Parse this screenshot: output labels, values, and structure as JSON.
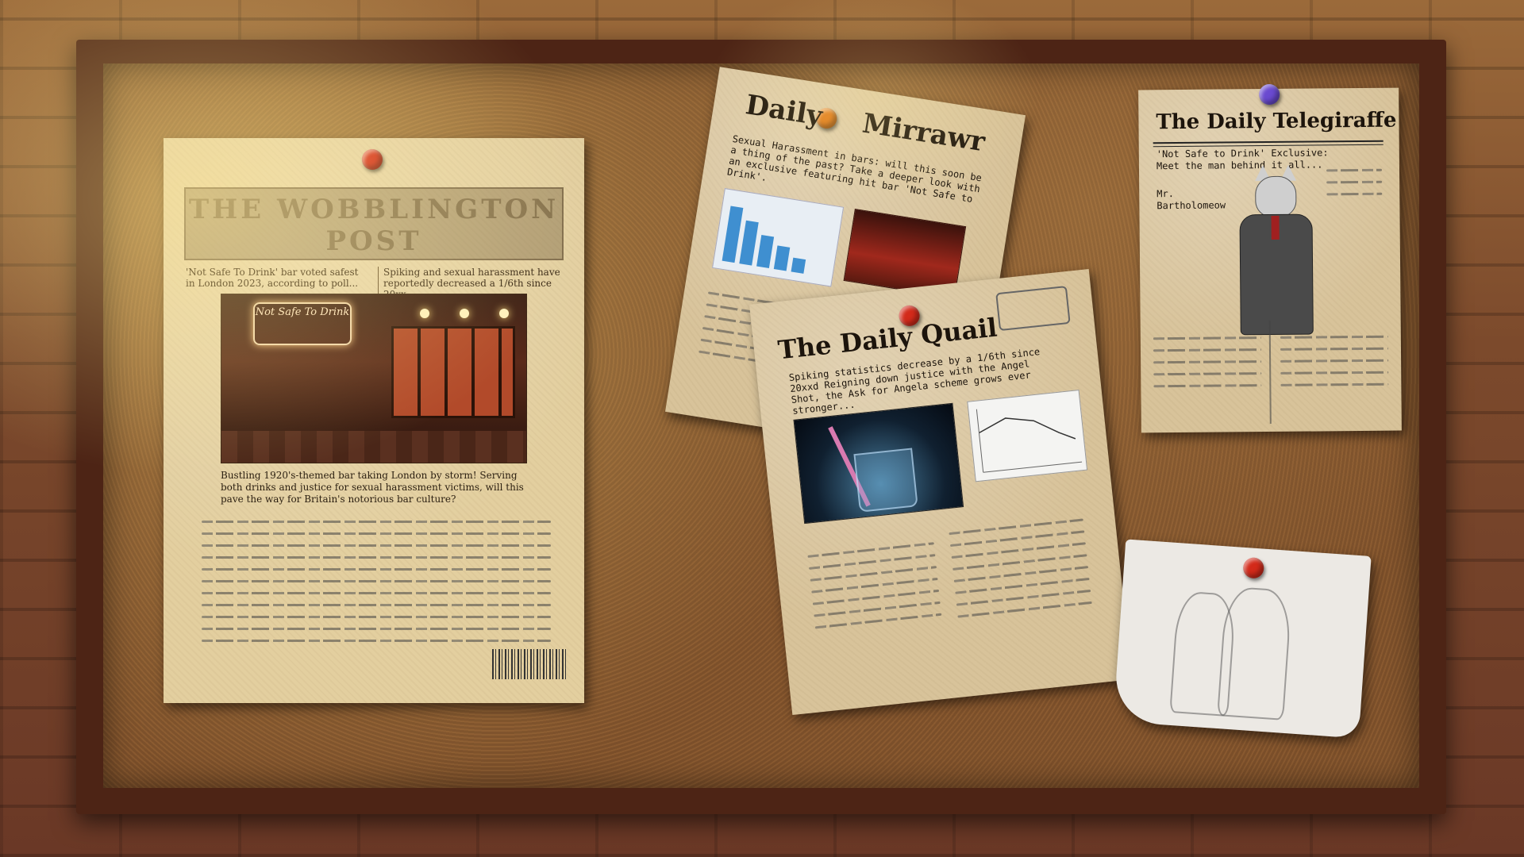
{
  "scene": {
    "colors": {
      "board_frame": "#4d2415",
      "cork": "#7e512c",
      "paper": "#d8c39a"
    }
  },
  "papers": {
    "left": {
      "masthead": "THE WOBBLINGTON POST",
      "headline1": "'Not Safe To Drink' bar voted safest in London 2023, according to poll...",
      "headline2": "Spiking and sexual harassment have reportedly decreased a 1/6th since 20xx",
      "sign_text": "Not Safe To Drink",
      "caption": "Bustling 1920's-themed bar taking London by storm! Serving both drinks and justice for sexual harassment victims, will this pave the way for Britain's notorious bar culture?"
    },
    "mirrawr": {
      "title_left": "Daily",
      "title_right": "Mirrawr",
      "lede": "Sexual Harassment in bars: will this soon be a thing of the past? Take a deeper look with an exclusive featuring hit bar 'Not Safe to Drink'."
    },
    "quail": {
      "title": "The Daily Quail",
      "lede": "Spiking statistics decrease by a 1/6th since 20xxd Reigning down justice with the Angel Shot, the Ask for Angela scheme grows ever stronger..."
    },
    "telegiraffe": {
      "title": "The Daily Telegiraffe",
      "lede": "'Not Safe to Drink' Exclusive: Meet the man behind it all...",
      "name": "Mr. Bartholomeow"
    }
  },
  "pins": {
    "left": "#d32a1a",
    "mirrawr": "#e07a1a",
    "quail": "#d32a1a",
    "telegiraffe": "#6a4ad0",
    "sticky": "#d32a1a"
  }
}
